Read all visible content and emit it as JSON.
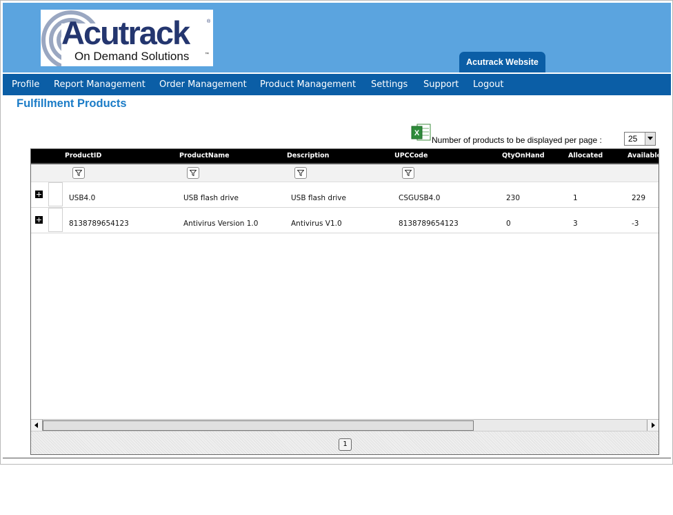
{
  "header": {
    "logo": {
      "name": "Acutrack",
      "registered_mark": "®",
      "tagline": "On Demand Solutions",
      "trademark": "™",
      "brand_color": "#24366f"
    },
    "website_tab": "Acutrack Website",
    "background_color": "#5ba4df"
  },
  "nav": {
    "background_color": "#0b5ea6",
    "items": [
      {
        "label": "Profile"
      },
      {
        "label": "Report Management"
      },
      {
        "label": "Order Management"
      },
      {
        "label": "Product Management"
      },
      {
        "label": "Settings"
      },
      {
        "label": "Support"
      },
      {
        "label": "Logout"
      }
    ]
  },
  "page": {
    "title": "Fulfillment Products",
    "export_icon": "excel-icon",
    "per_page_label": "Number of products to be displayed per page :",
    "per_page_value": "25"
  },
  "grid": {
    "columns": [
      "ProductID",
      "ProductName",
      "Description",
      "UPCCode",
      "QtyOnHand",
      "Allocated",
      "Available"
    ],
    "rows": [
      {
        "ProductID": "USB4.0",
        "ProductName": "USB flash drive",
        "Description": "USB flash drive",
        "UPCCode": "CSGUSB4.0",
        "QtyOnHand": "230",
        "Allocated": "1",
        "Available": "229"
      },
      {
        "ProductID": "8138789654123",
        "ProductName": "Antivirus Version 1.0",
        "Description": "Antivirus V1.0",
        "UPCCode": "8138789654123",
        "QtyOnHand": "0",
        "Allocated": "3",
        "Available": "-3"
      }
    ],
    "pager": {
      "current_page": "1"
    }
  }
}
